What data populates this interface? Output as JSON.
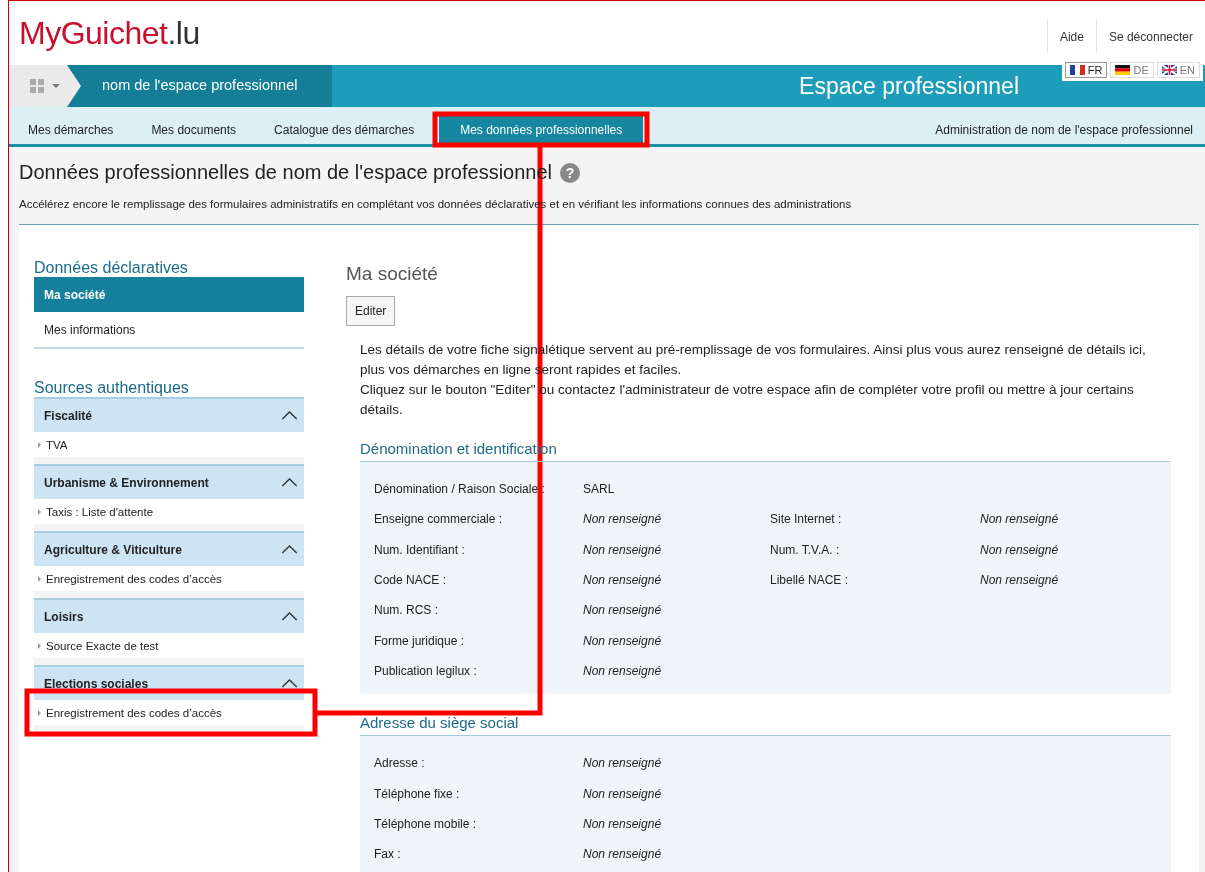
{
  "header": {
    "logo_prefix": "MyGuichet",
    "logo_suffix": ".lu",
    "links": [
      "Aide",
      "Se déconnecter"
    ],
    "languages": [
      {
        "code": "FR",
        "selected": true,
        "kind": "fr"
      },
      {
        "code": "DE",
        "selected": false,
        "kind": "de"
      },
      {
        "code": "EN",
        "selected": false,
        "kind": "en"
      }
    ]
  },
  "space_bar": {
    "space_name": "nom de l'espace professionnel",
    "title": "Espace professionnel"
  },
  "tabs": [
    {
      "label": "Mes démarches",
      "selected": false
    },
    {
      "label": "Mes documents",
      "selected": false
    },
    {
      "label": "Catalogue des démarches",
      "selected": false
    },
    {
      "label": "Mes données professionnelles",
      "selected": true
    }
  ],
  "admin_link": "Administration de nom de l'espace professionnel",
  "page": {
    "title": "Données professionnelles de nom de l'espace professionnel",
    "help": "?",
    "subtitle": "Accélérez encore le remplissage des formulaires administratifs en complétant vos données déclaratives et en vérifiant les informations connues des administrations"
  },
  "sidebar": {
    "declarative_title": "Données déclaratives",
    "declarative_items": [
      {
        "label": "Ma société",
        "selected": true
      },
      {
        "label": "Mes informations",
        "selected": false
      }
    ],
    "sources_title": "Sources authentiques",
    "sources": [
      {
        "title": "Fiscalité",
        "expanded": true,
        "items": [
          "TVA"
        ]
      },
      {
        "title": "Urbanisme & Environnement",
        "expanded": true,
        "items": [
          "Taxis : Liste d'attente"
        ]
      },
      {
        "title": "Agriculture & Viticulture",
        "expanded": true,
        "items": [
          "Enregistrement des codes d’accès"
        ]
      },
      {
        "title": "Loisirs",
        "expanded": true,
        "items": [
          "Source Exacte de test"
        ]
      },
      {
        "title": "Elections sociales",
        "expanded": true,
        "items": [
          "Enregistrement des codes d’accès"
        ]
      }
    ]
  },
  "main": {
    "title": "Ma société",
    "edit_button": "Editer",
    "intro": [
      "Les détails de votre fiche signalétique servent au pré-remplissage de vos formulaires. Ainsi plus vous aurez renseigné de détails ici, plus vos démarches en ligne seront rapides et faciles.",
      "Cliquez sur le bouton \"Editer\" ou contactez l'administrateur de votre espace afin de compléter votre profil ou mettre à jour certains détails."
    ],
    "sections": [
      {
        "title": "Dénomination et identification",
        "rows": [
          [
            {
              "label": "Dénomination / Raison Sociale :",
              "value": "SARL",
              "empty": false
            }
          ],
          [
            {
              "label": "Enseigne commerciale :",
              "value": "Non renseigné",
              "empty": true
            },
            {
              "label": "Site Internet :",
              "value": "Non renseigné",
              "empty": true
            }
          ],
          [
            {
              "label": "Num. Identifiant :",
              "value": "Non renseigné",
              "empty": true
            },
            {
              "label": "Num. T.V.A. :",
              "value": "Non renseigné",
              "empty": true
            }
          ],
          [
            {
              "label": "Code NACE :",
              "value": "Non renseigné",
              "empty": true
            },
            {
              "label": "Libellé NACE :",
              "value": "Non renseigné",
              "empty": true
            }
          ],
          [
            {
              "label": "Num. RCS :",
              "value": "Non renseigné",
              "empty": true
            }
          ],
          [
            {
              "label": "Forme juridique :",
              "value": "Non renseigné",
              "empty": true
            }
          ],
          [
            {
              "label": "Publication legilux :",
              "value": "Non renseigné",
              "empty": true
            }
          ]
        ]
      },
      {
        "title": "Adresse du siège social",
        "rows": [
          [
            {
              "label": "Adresse :",
              "value": "Non renseigné",
              "empty": true
            }
          ],
          [
            {
              "label": "Téléphone fixe :",
              "value": "Non renseigné",
              "empty": true
            }
          ],
          [
            {
              "label": "Téléphone mobile :",
              "value": "Non renseigné",
              "empty": true
            }
          ],
          [
            {
              "label": "Fax :",
              "value": "Non renseigné",
              "empty": true
            }
          ]
        ]
      }
    ]
  },
  "annotation": {
    "visible": true,
    "color": "#ff0000"
  }
}
